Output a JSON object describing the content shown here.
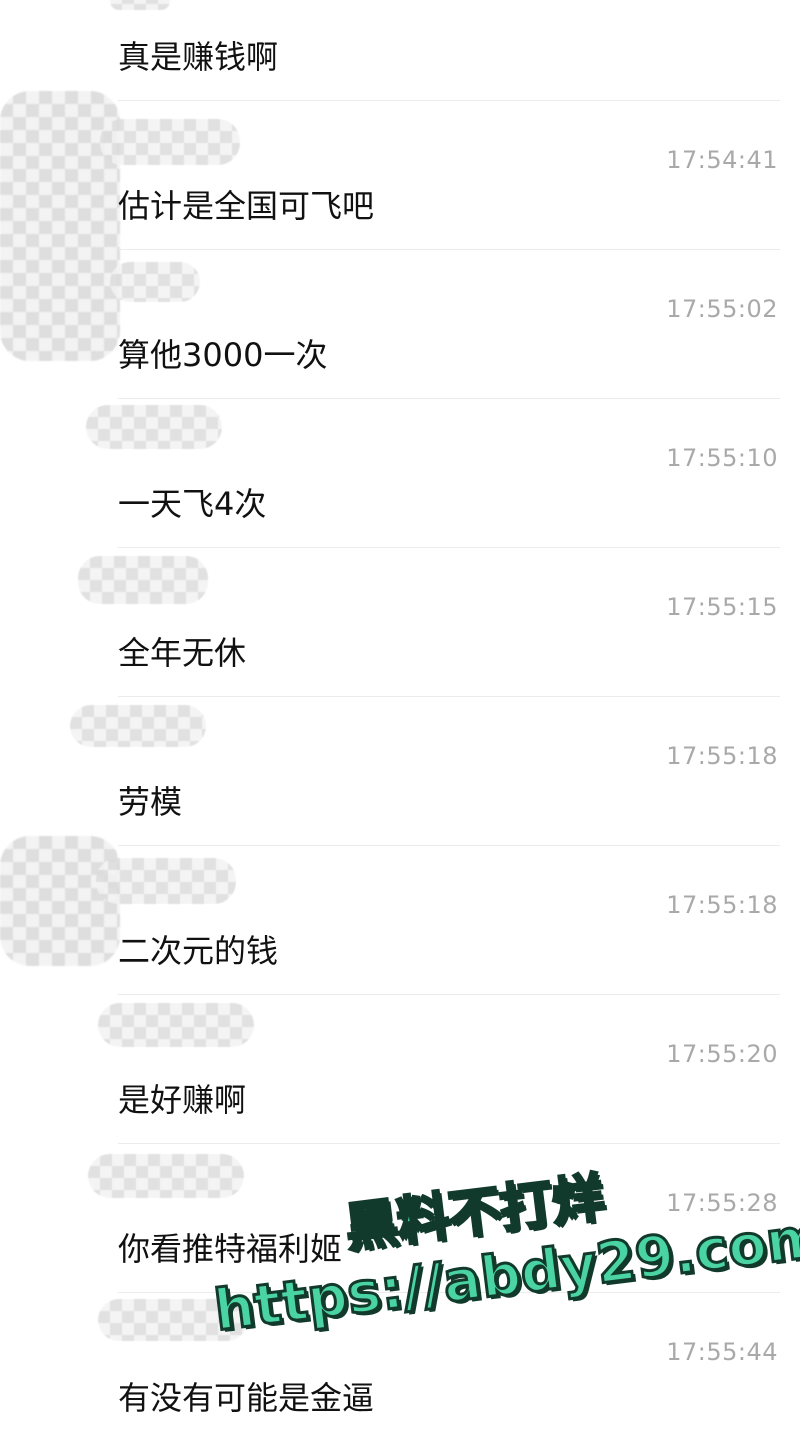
{
  "messages": [
    {
      "time": "",
      "text": "真是赚钱啊"
    },
    {
      "time": "17:54:41",
      "text": "估计是全国可飞吧"
    },
    {
      "time": "17:55:02",
      "text": "算他3000一次"
    },
    {
      "time": "17:55:10",
      "text": "一天飞4次"
    },
    {
      "time": "17:55:15",
      "text": "全年无休"
    },
    {
      "time": "17:55:18",
      "text": "劳模"
    },
    {
      "time": "17:55:18",
      "text": "二次元的钱"
    },
    {
      "time": "17:55:20",
      "text": "是好赚啊"
    },
    {
      "time": "17:55:28",
      "text": "你看推特福利姬"
    },
    {
      "time": "17:55:44",
      "text": "有没有可能是金逼"
    }
  ],
  "watermark": {
    "line1": "黑料不打烊",
    "line2": "https://abdy29.com"
  },
  "colors": {
    "timestamp": "#a9a9a9",
    "divider": "#ececec",
    "watermark_fill": "#4ad4a4",
    "watermark_stroke": "#123a2c"
  }
}
